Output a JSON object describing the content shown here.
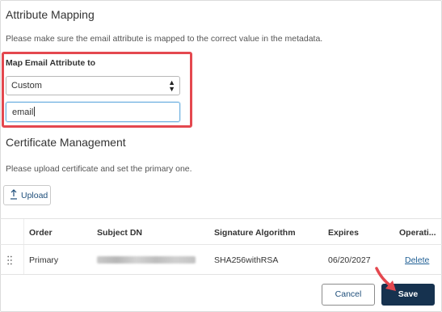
{
  "attribute_mapping": {
    "title": "Attribute Mapping",
    "description": "Please make sure the email attribute is mapped to the correct value in the metadata.",
    "field_label": "Map Email Attribute to",
    "select_value": "Custom",
    "input_value": "email"
  },
  "certificate_management": {
    "title": "Certificate Management",
    "description": "Please upload certificate and set the primary one.",
    "upload_label": "Upload"
  },
  "table": {
    "headers": {
      "order": "Order",
      "subject_dn": "Subject DN",
      "signature_algorithm": "Signature Algorithm",
      "expires": "Expires",
      "operations": "Operati..."
    },
    "rows": [
      {
        "order": "Primary",
        "signature_algorithm": "SHA256withRSA",
        "expires": "06/20/2027",
        "action": "Delete"
      }
    ]
  },
  "footer": {
    "cancel_label": "Cancel",
    "save_label": "Save"
  },
  "colors": {
    "highlight": "#e4484f",
    "save_button": "#16324f",
    "link": "#1f5f94",
    "input_focus": "#6fb1e0"
  },
  "icons": [
    "upload-icon",
    "select-arrows-icon",
    "drag-handle-icon",
    "annotation-arrow"
  ]
}
